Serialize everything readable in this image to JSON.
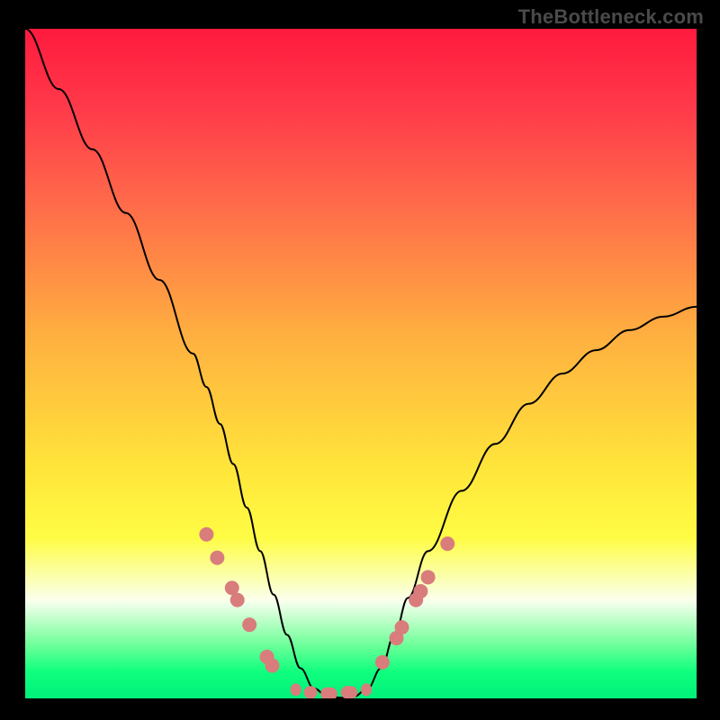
{
  "attribution": "TheBottleneck.com",
  "colors": {
    "frame": "#000000",
    "gradient_top": "#ff1a3e",
    "gradient_bottom": "#00f07a",
    "curve": "#000000",
    "marker": "#d87d7c"
  },
  "chart_data": {
    "type": "line",
    "title": "",
    "xlabel": "",
    "ylabel": "",
    "xlim": [
      0,
      100
    ],
    "ylim": [
      0,
      100
    ],
    "x": [
      0,
      5,
      10,
      15,
      20,
      25,
      27,
      29,
      31,
      33,
      35,
      37,
      39,
      41,
      43,
      45,
      47,
      49,
      51,
      53,
      55,
      57,
      60,
      65,
      70,
      75,
      80,
      85,
      90,
      95,
      100
    ],
    "values": [
      100,
      91,
      82,
      72.5,
      62.5,
      51.5,
      46.5,
      41,
      35,
      28.5,
      22,
      15.5,
      9.5,
      4.5,
      1.5,
      0.3,
      0.1,
      0.3,
      1.5,
      4.5,
      9.5,
      15,
      22,
      31,
      38,
      44,
      48.5,
      52,
      55,
      57,
      58.5
    ],
    "series": [
      {
        "name": "bottleneck-curve",
        "x_ref": "x",
        "y_ref": "values"
      }
    ],
    "markers_left": [
      {
        "x": 27.0,
        "y": 24.5
      },
      {
        "x": 28.6,
        "y": 21.0
      },
      {
        "x": 30.8,
        "y": 16.5
      },
      {
        "x": 31.6,
        "y": 14.7
      },
      {
        "x": 33.4,
        "y": 11.0
      },
      {
        "x": 36.0,
        "y": 6.2
      },
      {
        "x": 36.8,
        "y": 4.9
      }
    ],
    "markers_right": [
      {
        "x": 53.2,
        "y": 5.4
      },
      {
        "x": 55.3,
        "y": 9.0
      },
      {
        "x": 56.1,
        "y": 10.6
      },
      {
        "x": 58.2,
        "y": 14.7
      },
      {
        "x": 58.9,
        "y": 16.0
      },
      {
        "x": 60.0,
        "y": 18.1
      },
      {
        "x": 62.9,
        "y": 23.1
      }
    ],
    "valley_segments": [
      {
        "x0": 39.5,
        "x1": 41.0,
        "y": 1.3
      },
      {
        "x0": 41.5,
        "x1": 43.5,
        "y": 0.9
      },
      {
        "x0": 44.0,
        "x1": 46.5,
        "y": 0.7
      },
      {
        "x0": 47.0,
        "x1": 49.5,
        "y": 0.9
      },
      {
        "x0": 50.0,
        "x1": 51.5,
        "y": 1.3
      }
    ],
    "background_gradient": [
      {
        "pct": 0,
        "color": "#ff1a3e"
      },
      {
        "pct": 26,
        "color": "#ff6a4a"
      },
      {
        "pct": 66,
        "color": "#ffe63a"
      },
      {
        "pct": 85,
        "color": "#fbffeb"
      },
      {
        "pct": 100,
        "color": "#00f07a"
      }
    ]
  }
}
